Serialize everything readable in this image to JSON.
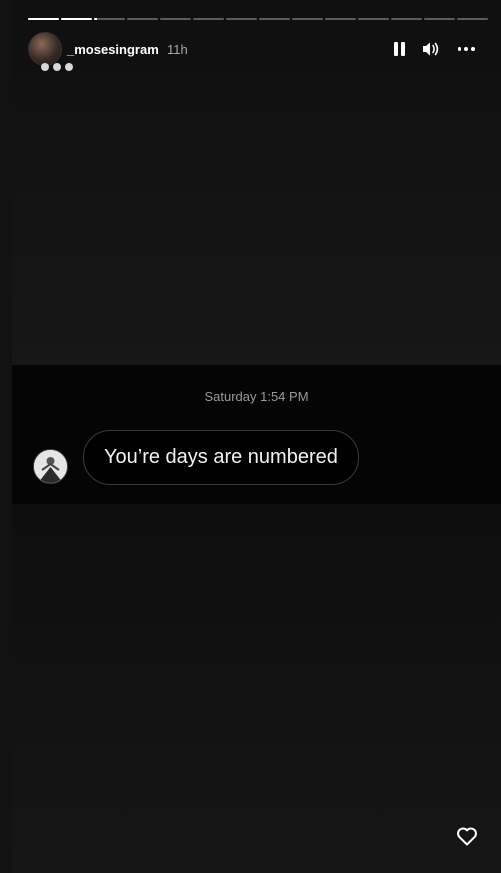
{
  "story": {
    "progress": {
      "segments": 14,
      "current_index": 2,
      "current_fraction": 0.1
    },
    "header": {
      "username": "_mosesingram",
      "time_ago": "11h"
    },
    "controls": {
      "pause_icon": "pause-icon",
      "volume_icon": "volume-icon",
      "more_icon": "more-icon"
    },
    "dm": {
      "timestamp": "Saturday 1:54 PM",
      "message": "You’re days are numbered"
    },
    "footer": {
      "like_icon": "heart-icon"
    }
  }
}
